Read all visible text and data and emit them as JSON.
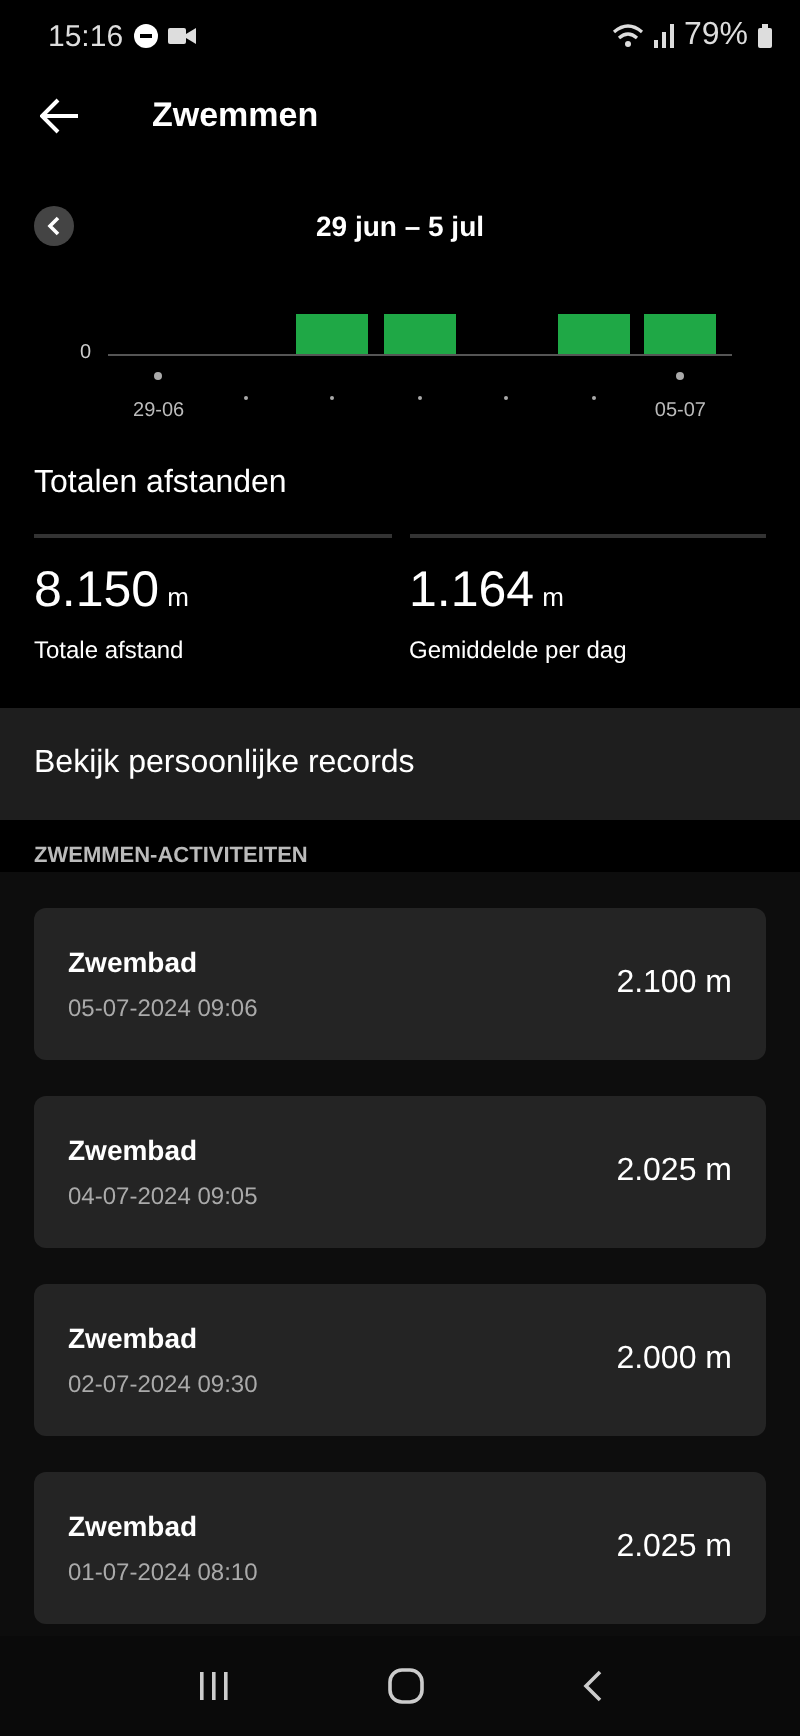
{
  "status_bar": {
    "time": "15:16",
    "battery": "79%"
  },
  "header": {
    "title": "Zwemmen"
  },
  "chart": {
    "range": "29 jun – 5 jul",
    "zero_label": "0",
    "days": [
      {
        "active": false,
        "label": "29-06"
      },
      {
        "active": false
      },
      {
        "active": true
      },
      {
        "active": true
      },
      {
        "active": false
      },
      {
        "active": true
      },
      {
        "active": true,
        "label": "05-07"
      }
    ]
  },
  "totals": {
    "title": "Totalen afstanden",
    "stats": [
      {
        "value": "8.150",
        "unit": "m",
        "label": "Totale afstand"
      },
      {
        "value": "1.164",
        "unit": "m",
        "label": "Gemiddelde per dag"
      }
    ]
  },
  "records_link": "Bekijk persoonlijke records",
  "activities": {
    "heading": "ZWEMMEN-ACTIVITEITEN",
    "items": [
      {
        "name": "Zwembad",
        "date": "05-07-2024 09:06",
        "distance": "2.100 m"
      },
      {
        "name": "Zwembad",
        "date": "04-07-2024 09:05",
        "distance": "2.025 m"
      },
      {
        "name": "Zwembad",
        "date": "02-07-2024 09:30",
        "distance": "2.000 m"
      },
      {
        "name": "Zwembad",
        "date": "01-07-2024 08:10",
        "distance": "2.025 m"
      }
    ]
  }
}
